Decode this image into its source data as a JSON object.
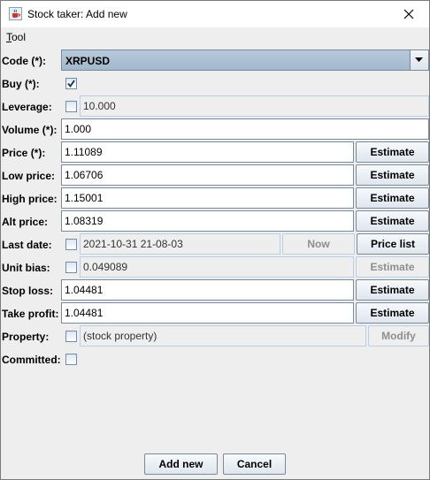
{
  "window": {
    "title": "Stock taker: Add new",
    "icon": "java-cup-icon",
    "close_icon": "close-icon"
  },
  "menu": {
    "tool_mnemonic": "T",
    "tool_rest": "ool"
  },
  "form": {
    "code": {
      "label": "Code (*):",
      "value": "XRPUSD"
    },
    "buy": {
      "label": "Buy (*):",
      "checked": true
    },
    "leverage": {
      "label": "Leverage:",
      "checked": false,
      "value": "10.000"
    },
    "volume": {
      "label": "Volume (*):",
      "value": "1.000"
    },
    "price": {
      "label": "Price (*):",
      "value": "1.11089",
      "button": "Estimate"
    },
    "low_price": {
      "label": "Low price:",
      "value": "1.06706",
      "button": "Estimate"
    },
    "high_price": {
      "label": "High price:",
      "value": "1.15001",
      "button": "Estimate"
    },
    "alt_price": {
      "label": "Alt price:",
      "value": "1.08319",
      "button": "Estimate"
    },
    "last_date": {
      "label": "Last date:",
      "checked": false,
      "value": "2021-10-31 21-08-03",
      "now_button": "Now",
      "list_button": "Price list"
    },
    "unit_bias": {
      "label": "Unit bias:",
      "checked": false,
      "value": "0.049089",
      "button": "Estimate"
    },
    "stop_loss": {
      "label": "Stop loss:",
      "value": "1.04481",
      "button": "Estimate"
    },
    "take_profit": {
      "label": "Take profit:",
      "value": "1.04481",
      "button": "Estimate"
    },
    "property": {
      "label": "Property:",
      "checked": false,
      "value": "(stock property)",
      "button": "Modify"
    },
    "committed": {
      "label": "Committed:",
      "checked": false
    }
  },
  "footer": {
    "add_new": "Add new",
    "cancel": "Cancel"
  }
}
